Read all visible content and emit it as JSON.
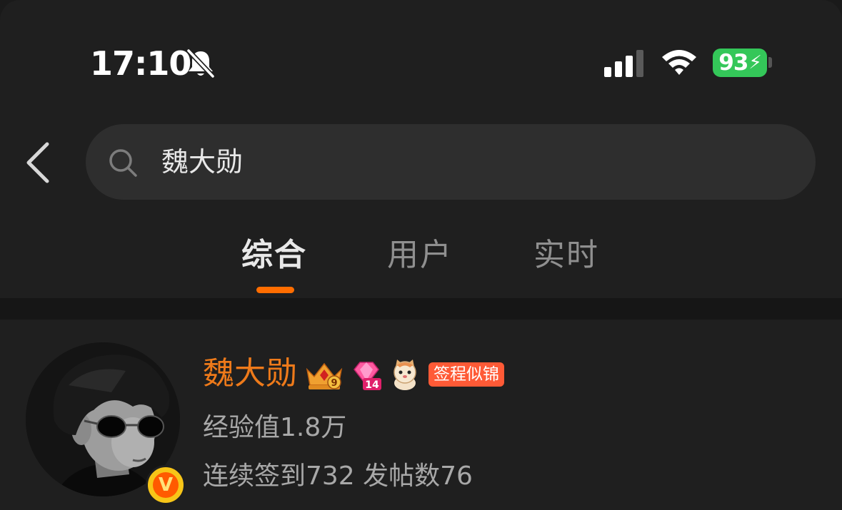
{
  "status_bar": {
    "time": "17:10",
    "battery": "93",
    "icons": [
      "bell-slash-icon",
      "signal-icon",
      "wifi-icon",
      "battery-charging-icon"
    ]
  },
  "search": {
    "query": "魏大勋",
    "icon": "search-icon"
  },
  "tabs": [
    {
      "label": "综合",
      "active": true
    },
    {
      "label": "用户",
      "active": false
    },
    {
      "label": "实时",
      "active": false
    }
  ],
  "user": {
    "name": "魏大勋",
    "badges": [
      "crown-level-9-icon",
      "gem-level-14-icon",
      "cartoon-cat-icon"
    ],
    "crown_level": "9",
    "gem_level": "14",
    "tag": "签程似锦",
    "verified_mark": "V",
    "exp": "经验值1.8万",
    "stats": "连续签到732 发帖数76"
  },
  "colors": {
    "accent": "#ff6d00",
    "username": "#ee7a1a",
    "battery": "#34c759",
    "tag_bg": "#ff5a36"
  }
}
